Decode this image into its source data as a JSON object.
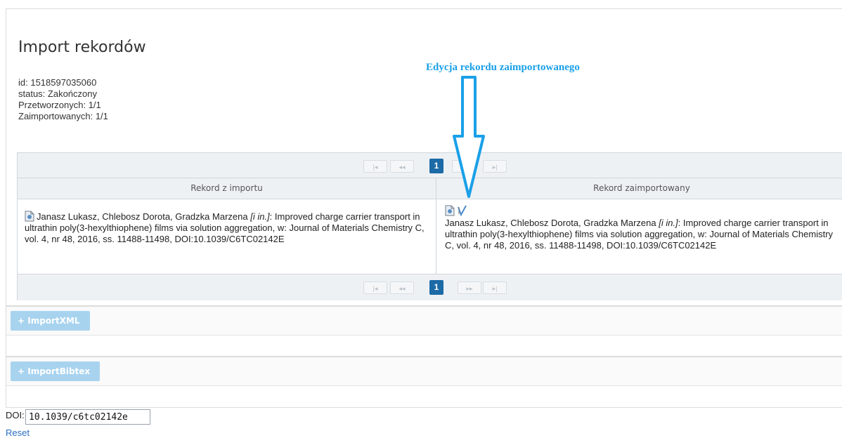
{
  "page": {
    "title": "Import rekordów"
  },
  "info": {
    "id": "id: 1518597035060",
    "status": "status: Zakończony",
    "processed": "Przetworzonych: 1/1",
    "imported": "Zaimportowanych: 1/1"
  },
  "annotation": {
    "text": "Edycja rekordu zaimportowanego",
    "color": "#1aa0e8"
  },
  "pager": {
    "first": "|◂",
    "prev": "◂◂",
    "current": "1",
    "next": "▸▸",
    "last": "▸|"
  },
  "table": {
    "headers": [
      "Rekord z importu",
      "Rekord zaimportowany"
    ],
    "import_record": {
      "authors": "Janasz Lukasz, Chlebosz Dorota, Gradzka Marzena ",
      "et_al": "[i in.]",
      "rest": ": Improved charge carrier transport in ultrathin poly(3-hexylthiophene) films via solution aggregation, w: Journal of Materials Chemistry C, vol. 4, nr 48, 2016, ss. 11488-11498, DOI:10.1039/C6TC02142E"
    },
    "imported_record": {
      "authors": "Janasz Lukasz, Chlebosz Dorota, Gradzka Marzena ",
      "et_al": "[i in.]",
      "rest": ": Improved charge carrier transport in ultrathin poly(3-hexylthiophene) films via solution aggregation, w: Journal of Materials Chemistry C, vol. 4, nr 48, 2016, ss. 11488-11498, DOI:10.1039/C6TC02142E"
    }
  },
  "buttons": {
    "import_xml": "ImportXML",
    "import_bibtex": "ImportBibtex"
  },
  "doi": {
    "label": "DOI:",
    "value": "10.1039/c6tc02142e"
  },
  "reset": {
    "label": "Reset"
  },
  "colors": {
    "accent": "#1c6aa6",
    "button_disabled": "#a8d3ef",
    "link": "#2a6fc4"
  }
}
